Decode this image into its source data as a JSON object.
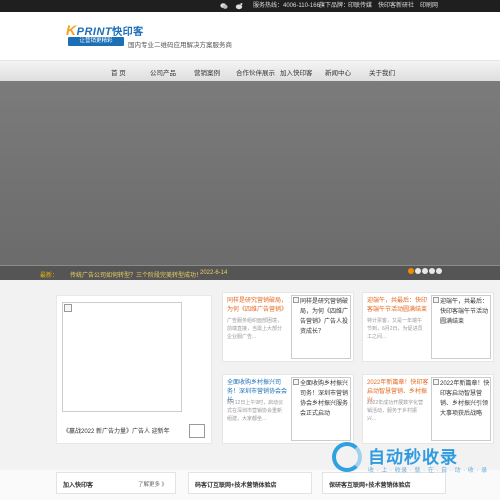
{
  "topbar": {
    "hotline": "服务热线：4006-110-166",
    "download": "旗下品牌：",
    "brand1": "印联传媒",
    "brand2": "快印客新研社",
    "brand3": "印刷网"
  },
  "header": {
    "brand_k": "K",
    "brand_word": "PRINT",
    "brand_cn": "快印客",
    "slogan": "让营销更精彩",
    "tagline": "国内专业二维码应用解决方案服务商"
  },
  "nav": {
    "items": [
      "首 页",
      "公司产品",
      "营销案例",
      "合作伙伴展示",
      "加入快印客",
      "新闻中心",
      "关于我们"
    ]
  },
  "ticker": {
    "tag": "最新：",
    "text": "传统广告公司如何转型？三个阶段完美转型成功！",
    "date": "2022-6-14"
  },
  "featured": {
    "caption": "《赢战2022 新广告力量》广告人 迎新年"
  },
  "cards": [
    {
      "title": "同样是研究营销破局，为何《四维广告营销》",
      "desc": "广告服务组织面部困境，前端直接，当需上大部分企业服广告...",
      "alt": "同样是研究营销破局，为何《四维广告营销》广告人投资成长？"
    },
    {
      "title": "迎端午，共最后：快印客端午节活动圆满结束",
      "desc": "特计票客，又是一年端午节到，6月2日，为促进员工之间...",
      "alt": "迎端午，共最后：快印客端午节活动圆满结束"
    },
    {
      "title": "全面收购乡村振兴司务！深圳市营销协会会长",
      "desc": "5月12日上午9时，启动仪式在深圳市营销协会重新组建，大家都坐...",
      "alt": "全面收购乡村振兴司务！深圳市营销协会乡村振兴服务会正式启动"
    },
    {
      "title": "2022年新篇章！快印客启动智慧营销、乡村振兴",
      "desc": "2022年成功开展数字化营销活动，服务于乡村振兴...",
      "alt": "2022年新篇章！快印客启动智慧营销、乡村振兴引领大事项获后战略"
    }
  ],
  "footer": {
    "box1_title": "加入快印客",
    "box1_more": "了解更多 》",
    "box2_title": "码客订互联网+技术营销体验店",
    "box3_title": "保研客互联网+技术营销体验店"
  },
  "watermark": {
    "title": "自动秒收录",
    "sub": "收 · 上 · 收录 · 就 · 在 · 自 · 动 · 收 · 录"
  },
  "colors": {
    "accent": "#1c6fb7",
    "orange": "#e2681f",
    "banner": "#737373"
  }
}
